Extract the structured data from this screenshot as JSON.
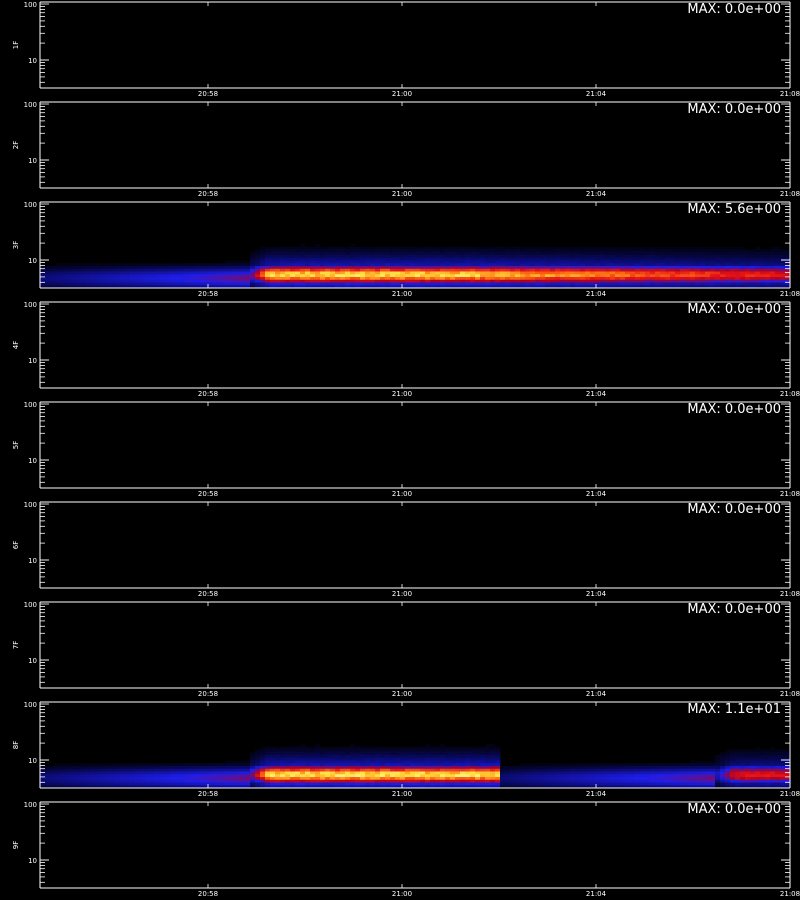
{
  "chart_data": {
    "type": "heatmap",
    "x_axis": {
      "ticks": [
        "20:58",
        "21:00",
        "21:04",
        "21:08"
      ]
    },
    "y_axis": {
      "scale": "log",
      "ticks": [
        "100",
        "10"
      ]
    },
    "colors": {
      "background": "#000000",
      "axis": "#ffffff",
      "colormap": [
        "#000000",
        "#0000c8",
        "#c80000",
        "#ff8000",
        "#ffff96"
      ]
    },
    "panels": [
      {
        "label": "1F",
        "max_label": "MAX: 0.0e+00",
        "bands": []
      },
      {
        "label": "2F",
        "max_label": "MAX: 0.0e+00",
        "bands": []
      },
      {
        "label": "3F",
        "max_label": "MAX: 5.6e+00",
        "bands": [
          {
            "t_start": 0.28,
            "t_end": 1.0,
            "peak": 0.95,
            "fade_start": 0.55,
            "fade_to": 0.62
          }
        ]
      },
      {
        "label": "4F",
        "max_label": "MAX: 0.0e+00",
        "bands": []
      },
      {
        "label": "5F",
        "max_label": "MAX: 0.0e+00",
        "bands": []
      },
      {
        "label": "6F",
        "max_label": "MAX: 0.0e+00",
        "bands": []
      },
      {
        "label": "7F",
        "max_label": "MAX: 0.0e+00",
        "bands": []
      },
      {
        "label": "8F",
        "max_label": "MAX: 1.1e+01",
        "bands": [
          {
            "t_start": 0.28,
            "t_end": 0.61,
            "peak": 0.97,
            "fade_start": 1.0,
            "fade_to": 1.0
          },
          {
            "t_start": 0.9,
            "t_end": 1.0,
            "peak": 0.62,
            "fade_start": 1.0,
            "fade_to": 1.0
          }
        ]
      },
      {
        "label": "9F",
        "max_label": "MAX: 0.0e+00",
        "bands": []
      }
    ]
  }
}
